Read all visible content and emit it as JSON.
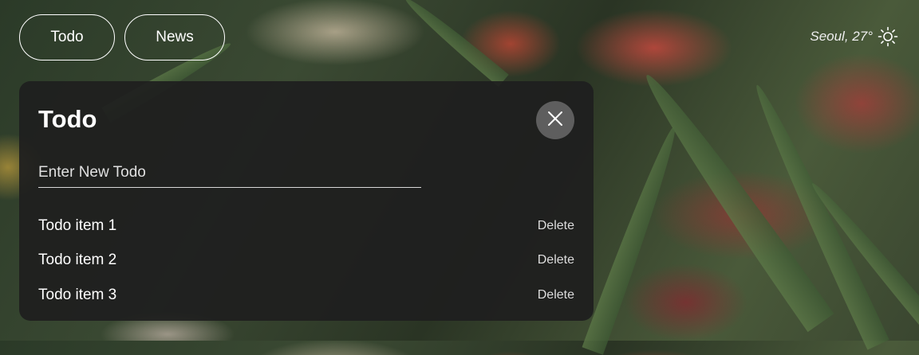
{
  "nav": {
    "tabs": [
      {
        "label": "Todo"
      },
      {
        "label": "News"
      }
    ]
  },
  "weather": {
    "text": "Seoul, 27°",
    "icon": "sun-icon"
  },
  "todo_panel": {
    "title": "Todo",
    "close_icon": "close-icon",
    "input_placeholder": "Enter New Todo",
    "input_value": "",
    "items": [
      {
        "text": "Todo item 1",
        "action": "Delete"
      },
      {
        "text": "Todo item 2",
        "action": "Delete"
      },
      {
        "text": "Todo item 3",
        "action": "Delete"
      }
    ]
  }
}
